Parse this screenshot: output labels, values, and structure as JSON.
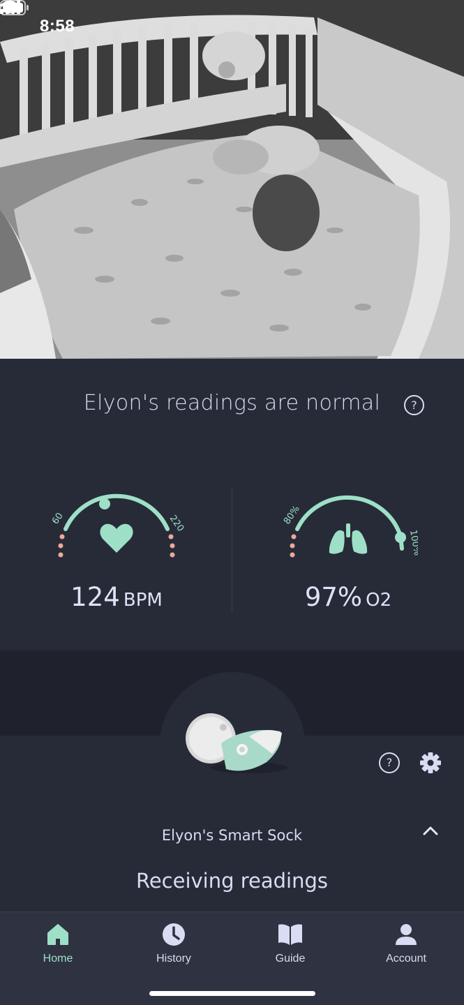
{
  "status_bar": {
    "time": "8:58"
  },
  "readings": {
    "title": "Elyon's readings are normal",
    "heart_rate": {
      "value": "124",
      "unit": "BPM",
      "min_label": "60",
      "max_label": "220",
      "level": 124
    },
    "oxygen": {
      "value": "97%",
      "unit": "O2",
      "min_label": "80%",
      "max_label": "100%",
      "level": 97
    }
  },
  "device": {
    "name": "Elyon's Smart Sock",
    "status": "Receiving readings"
  },
  "tabs": [
    {
      "label": "Home",
      "icon": "home-icon",
      "active": true
    },
    {
      "label": "History",
      "icon": "clock-icon",
      "active": false
    },
    {
      "label": "Guide",
      "icon": "book-icon",
      "active": false
    },
    {
      "label": "Account",
      "icon": "person-icon",
      "active": false
    }
  ],
  "colors": {
    "accent": "#9ee0c7",
    "warning_dots": "#f0a898",
    "background": "#272b38",
    "text": "#d9dcf2"
  },
  "icons": [
    "location-arrow-icon",
    "signal-icon",
    "wifi-icon",
    "battery-icon",
    "help-icon",
    "heart-icon",
    "lungs-icon",
    "gear-icon",
    "chevron-up-icon"
  ]
}
